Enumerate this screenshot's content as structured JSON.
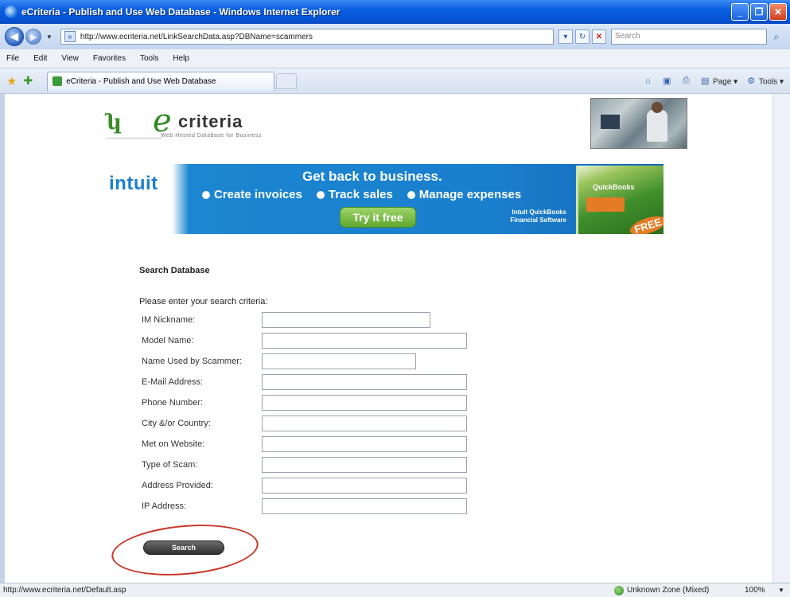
{
  "window": {
    "title": "eCriteria - Publish and Use Web Database - Windows Internet Explorer"
  },
  "address_bar": {
    "url": "http://www.ecriteria.net/LinkSearchData.asp?DBName=scammers",
    "search_placeholder": "Search"
  },
  "menu": [
    "File",
    "Edit",
    "View",
    "Favorites",
    "Tools",
    "Help"
  ],
  "tab": {
    "label": "eCriteria - Publish and Use Web Database"
  },
  "command_bar": {
    "page_label": "Page",
    "tools_label": "Tools"
  },
  "site": {
    "logo_text": "criteria",
    "logo_tagline": "Web Hosted Database for Business"
  },
  "banner": {
    "brand": "intuit",
    "headline": "Get back to business.",
    "features": [
      "Create invoices",
      "Track sales",
      "Manage expenses"
    ],
    "cta": "Try it free",
    "product_line1": "Intuit QuickBooks",
    "product_line2": "Financial Software",
    "box_label": "QuickBooks",
    "free_badge": "FREE"
  },
  "form": {
    "title": "Search Database",
    "intro": "Please enter your search criteria:",
    "fields": [
      {
        "label": "IM Nickname:",
        "value": ""
      },
      {
        "label": "Model Name:",
        "value": ""
      },
      {
        "label": "Name Used by Scammer:",
        "value": ""
      },
      {
        "label": "E-Mail Address:",
        "value": ""
      },
      {
        "label": "Phone Number:",
        "value": ""
      },
      {
        "label": "City &/or Country:",
        "value": ""
      },
      {
        "label": "Met on Website:",
        "value": ""
      },
      {
        "label": "Type of Scam:",
        "value": ""
      },
      {
        "label": "Address Provided:",
        "value": ""
      },
      {
        "label": "IP Address:",
        "value": ""
      }
    ],
    "search_button": "Search"
  },
  "status_bar": {
    "link": "http://www.ecriteria.net/Default.asp",
    "zone": "Unknown Zone (Mixed)",
    "zoom": "100%"
  },
  "colors": {
    "titlebar": "#0653d6",
    "banner_blue": "#1a7fcd",
    "annotation_red": "#c8372a"
  }
}
